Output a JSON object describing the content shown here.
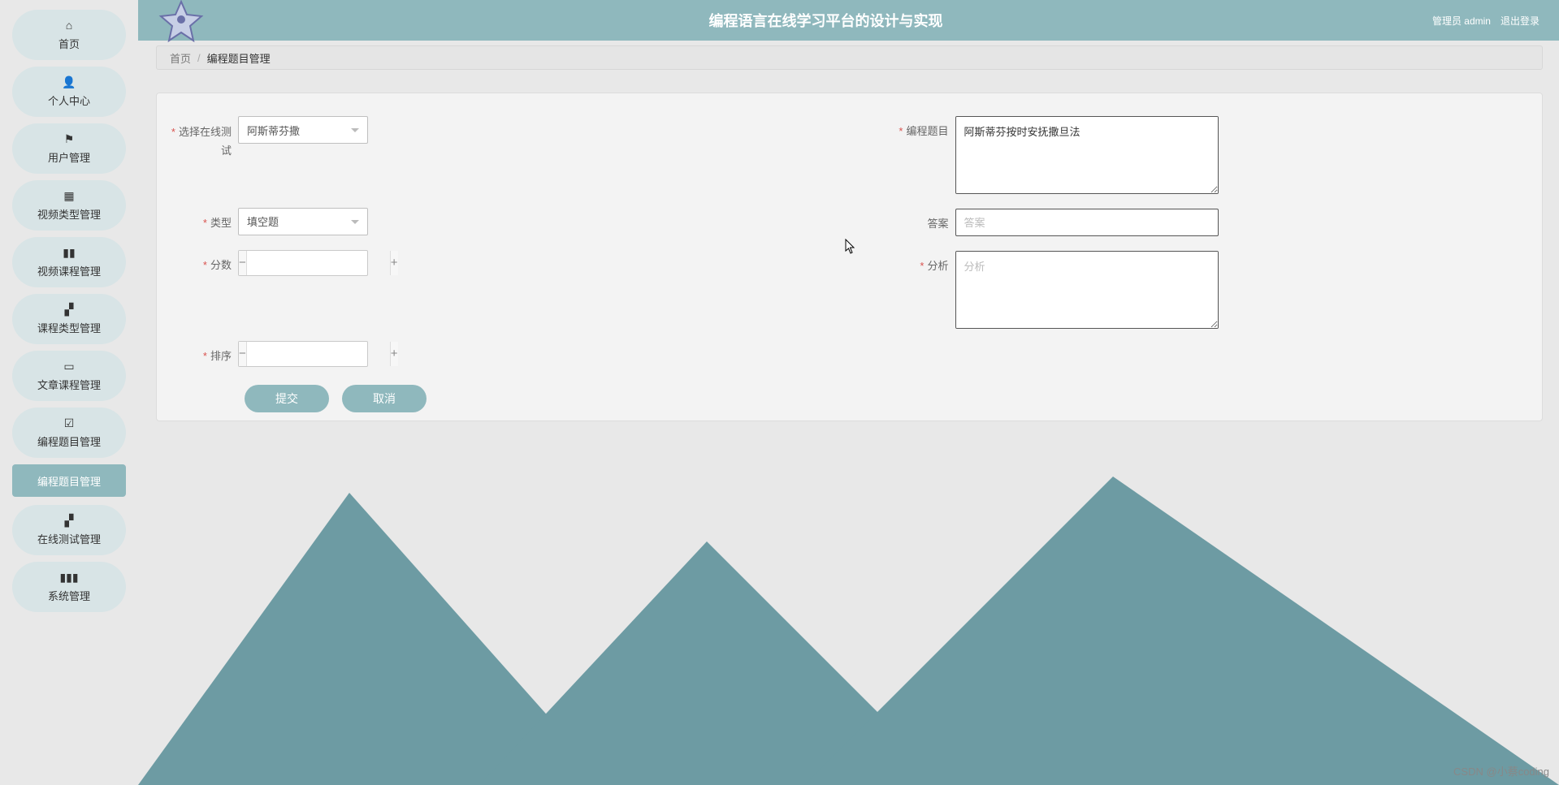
{
  "header": {
    "title": "编程语言在线学习平台的设计与实现",
    "admin_label": "管理员 admin",
    "logout_label": "退出登录"
  },
  "sidebar": {
    "items": [
      {
        "icon": "home",
        "label": "首页"
      },
      {
        "icon": "user",
        "label": "个人中心"
      },
      {
        "icon": "flag",
        "label": "用户管理"
      },
      {
        "icon": "grid",
        "label": "视频类型管理"
      },
      {
        "icon": "book",
        "label": "视频课程管理"
      },
      {
        "icon": "tiles",
        "label": "课程类型管理"
      },
      {
        "icon": "case",
        "label": "文章课程管理"
      },
      {
        "icon": "check",
        "label": "编程题目管理"
      },
      {
        "icon": "tiles",
        "label": "在线测试管理"
      },
      {
        "icon": "bars",
        "label": "系统管理"
      }
    ],
    "active_sub": "编程题目管理"
  },
  "breadcrumb": {
    "home": "首页",
    "current": "编程题目管理"
  },
  "form": {
    "select_test_label": "选择在线测试",
    "select_test_value": "阿斯蒂芬撒",
    "question_label": "编程题目",
    "question_value": "阿斯蒂芬按时安抚撒旦法",
    "type_label": "类型",
    "type_value": "填空题",
    "answer_label": "答案",
    "answer_placeholder": "答案",
    "answer_value": "",
    "score_label": "分数",
    "score_value": "",
    "analysis_label": "分析",
    "analysis_placeholder": "分析",
    "analysis_value": "",
    "order_label": "排序",
    "order_value": "",
    "submit": "提交",
    "cancel": "取消"
  },
  "watermark": "CSDN @小蔡coding",
  "colors": {
    "accent": "#8fb8bd",
    "required": "#d9534f"
  }
}
